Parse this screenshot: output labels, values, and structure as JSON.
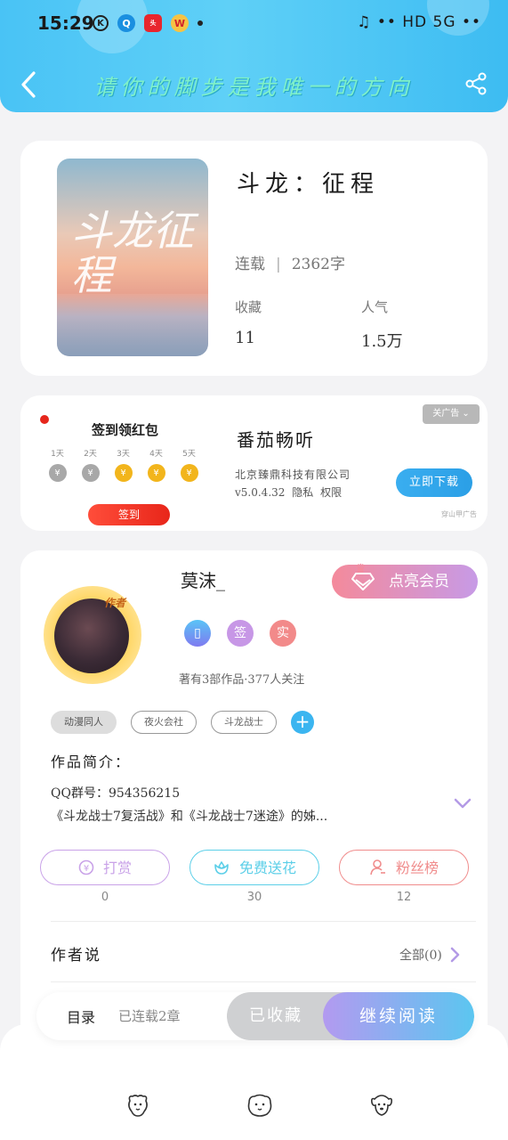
{
  "status_bar": {
    "time": "15:29",
    "right_icons": "♫ •• HD 5G ••"
  },
  "header": {
    "title": "请你的脚步是我唯一的方向",
    "accent_color": "#49c3f5"
  },
  "book": {
    "title": "斗龙：征程",
    "cover_title": "斗龙征程",
    "status": "连载",
    "word_count": "2362字",
    "favorites_label": "收藏",
    "favorites_value": "11",
    "popularity_label": "人气",
    "popularity_value": "1.5万"
  },
  "ad": {
    "image_title": "签到领红包",
    "days": [
      "1天",
      "2天",
      "3天",
      "4天",
      "5天"
    ],
    "button": "签到",
    "app_name": "番茄畅听",
    "company": "北京臻鼎科技有限公司",
    "version": "v5.0.4.32",
    "privacy": "隐私",
    "permission": "权限",
    "download": "立即下载",
    "close": "关广告",
    "source": "穿山甲广告"
  },
  "author": {
    "badge": "作者",
    "name": "莫沫_",
    "vip_button": "点亮会员",
    "badges": [
      "签",
      "实"
    ],
    "stats": "著有3部作品·377人关注",
    "tags": [
      "动漫同人",
      "夜火会社",
      "斗龙战士"
    ],
    "intro_label": "作品简介：",
    "intro_qq": "QQ群号：954356215",
    "intro_text": "《斗龙战士7复活战》和《斗龙战士7迷途》的姊...",
    "actions": [
      {
        "label": "打赏",
        "count": "0",
        "color": "#c9a2e8"
      },
      {
        "label": "免费送花",
        "count": "30",
        "color": "#5ccfe8"
      },
      {
        "label": "粉丝榜",
        "count": "12",
        "color": "#f08c8c"
      }
    ],
    "author_say": "作者说",
    "all_link": "全部(0)"
  },
  "bottom_bar": {
    "toc": "目录",
    "serial_count": "已连载2章",
    "collected": "已收藏",
    "continue_reading": "继续阅读"
  }
}
